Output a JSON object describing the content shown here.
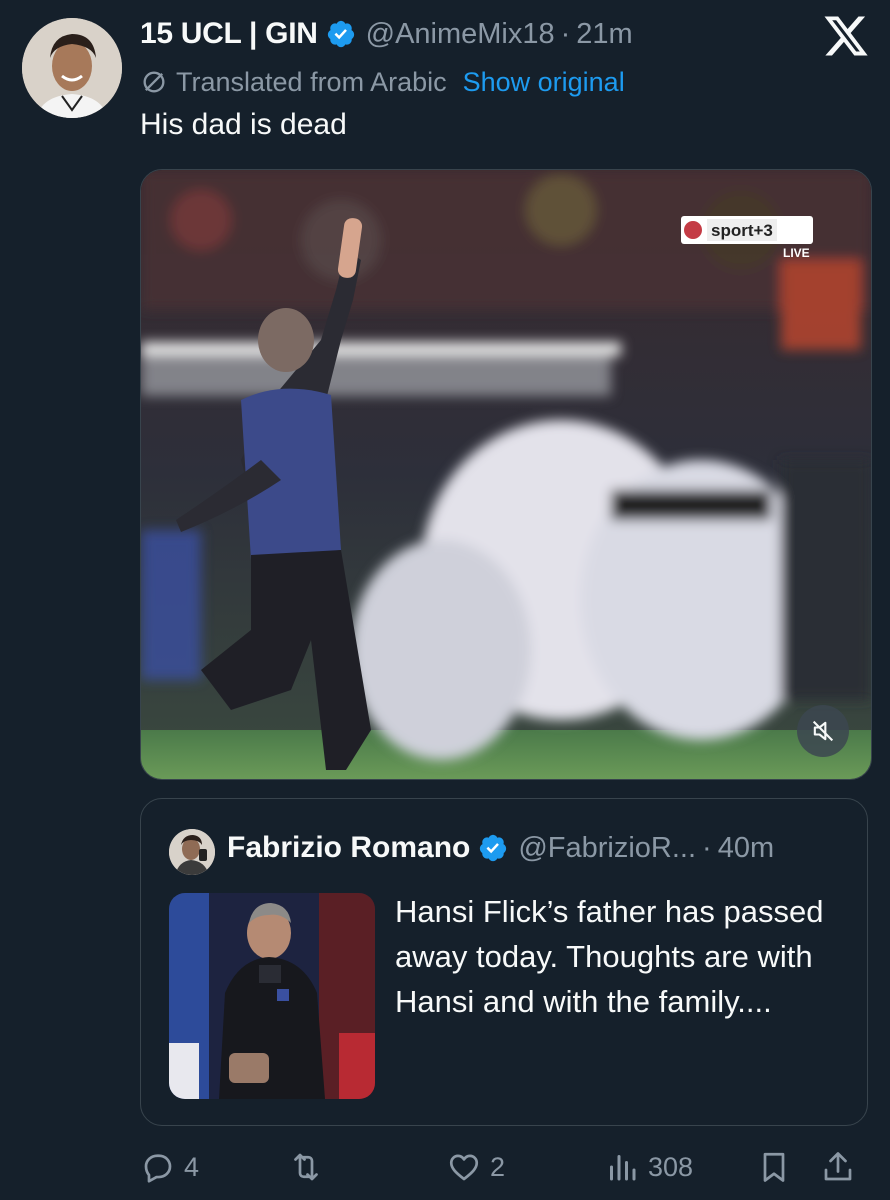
{
  "post": {
    "display_name": "15 UCL | GIN",
    "handle": "@AnimeMix18",
    "separator": "·",
    "time": "21m",
    "translated_label": "Translated from Arabic",
    "show_original": "Show original",
    "text": "His dad is dead"
  },
  "video": {
    "channel_logo": "sport+3",
    "live_label": "LIVE",
    "mute_icon": "speaker-muted-icon"
  },
  "quote": {
    "display_name": "Fabrizio Romano",
    "handle": "@FabrizioR...",
    "separator": "·",
    "time": "40m",
    "text": "Hansi Flick’s father has passed away today. Thoughts are with Hansi and with the family...."
  },
  "actions": {
    "replies": "4",
    "reposts": "",
    "likes": "2",
    "views": "308"
  },
  "colors": {
    "background": "#15202b",
    "accent": "#1d9bf0",
    "muted_text": "#8b98a5",
    "border": "#38444d"
  }
}
